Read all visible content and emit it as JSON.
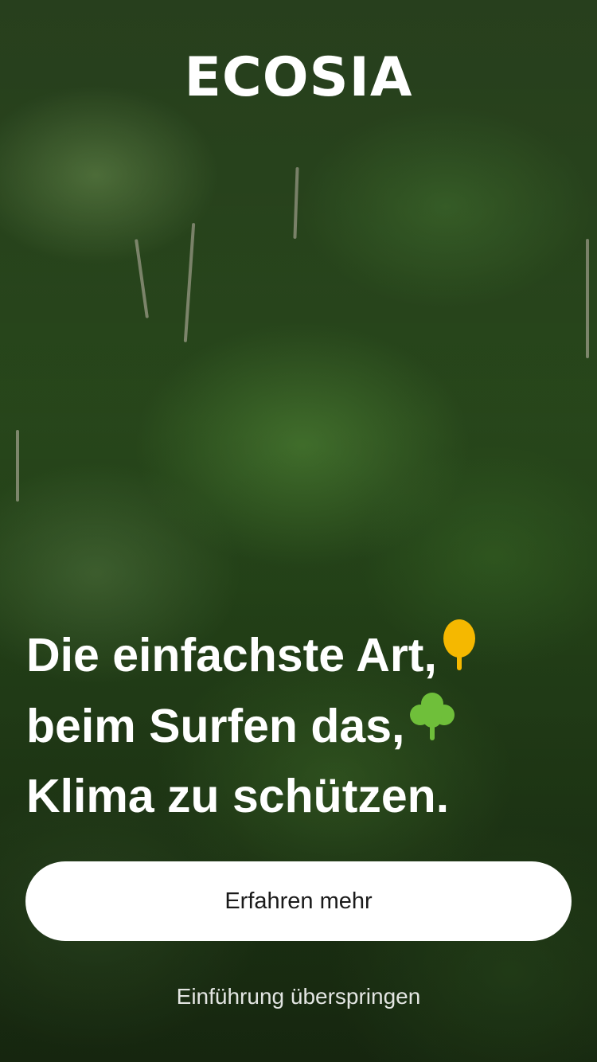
{
  "app": {
    "logo_text": "ECOSIA"
  },
  "background": {
    "image": "rainforest-canopy"
  },
  "headline": {
    "line1": "Die einfachste Art,",
    "line2": "beim Surfen das,",
    "line3": "Klima zu schützen.",
    "icon1": "yellow-tree-icon",
    "icon2": "green-tree-icon"
  },
  "actions": {
    "primary_label": "Erfahren mehr",
    "skip_label": "Einführung überspringen"
  },
  "colors": {
    "text": "#ffffff",
    "button_bg": "#ffffff",
    "button_text": "#1a1a1a",
    "tree_yellow": "#f5b800",
    "tree_green": "#6fbf3a"
  }
}
